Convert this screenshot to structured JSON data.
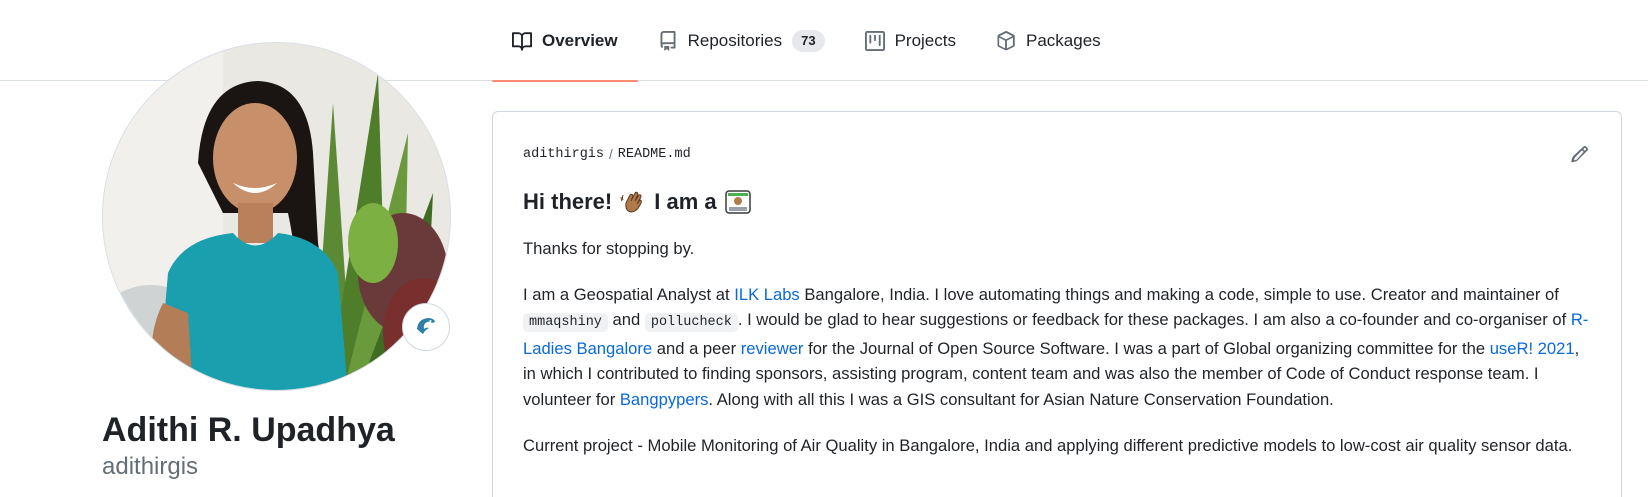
{
  "tabs": [
    {
      "label": "Overview",
      "icon": "book-icon",
      "active": true
    },
    {
      "label": "Repositories",
      "icon": "repo-icon",
      "count": "73"
    },
    {
      "label": "Projects",
      "icon": "project-icon"
    },
    {
      "label": "Packages",
      "icon": "package-icon"
    }
  ],
  "profile": {
    "full_name": "Adithi R. Upadhya",
    "username": "adithirgis",
    "status_icon": "dolphin-icon"
  },
  "readme": {
    "owner": "adithirgis",
    "separator": "/",
    "file_name": "README.md",
    "edit_icon": "pencil-icon",
    "heading_part1": "Hi there!",
    "heading_part2": "I am a",
    "p1": "Thanks for stopping by.",
    "p2": {
      "t1": "I am a Geospatial Analyst at ",
      "link_ilk": "ILK Labs",
      "t2": " Bangalore, India. I love automating things and making a code, simple to use. Creator and maintainer of ",
      "code1": "mmaqshiny",
      "t3": " and ",
      "code2": "pollucheck",
      "t4": ". I would be glad to hear suggestions or feedback for these packages. I am also a co-founder and co-organiser of ",
      "link_rladies": "R-Ladies Bangalore",
      "t5": " and a peer ",
      "link_reviewer": "reviewer",
      "t6": " for the Journal of Open Source Software. I was a part of Global organizing committee for the ",
      "link_user": "useR! 2021",
      "t7": ", in which I contributed to finding sponsors, assisting program, content team and was also the member of Code of Conduct response team. I volunteer for ",
      "link_bang": "Bangpypers",
      "t8": ". Along with all this I was a GIS consultant for Asian Nature Conservation Foundation."
    },
    "p3": "Current project - Mobile Monitoring of Air Quality in Bangalore, India and applying different predictive models to low-cost air quality sensor data."
  },
  "colors": {
    "link": "#0969da",
    "active_tab_underline": "#fd8c73",
    "text": "#1f2328",
    "muted": "#656d76"
  }
}
